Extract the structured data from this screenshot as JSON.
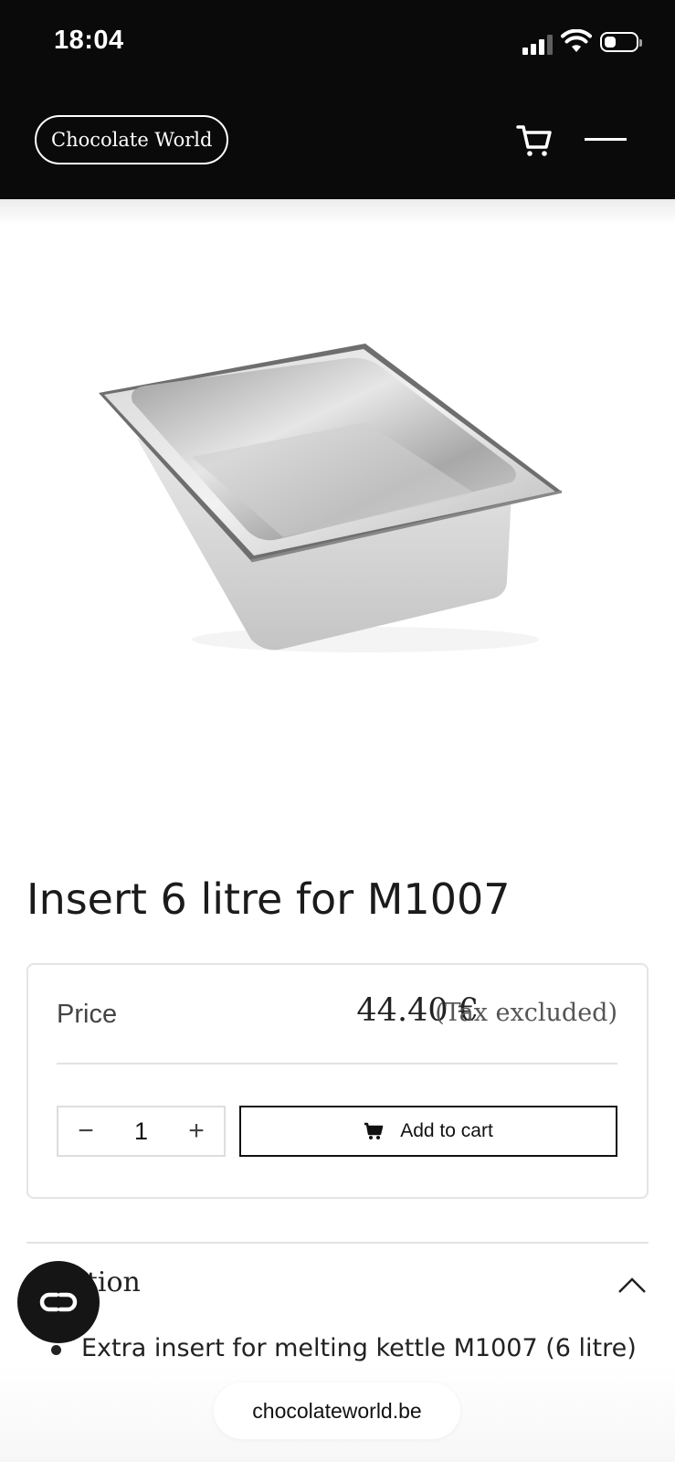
{
  "status_bar": {
    "time": "18:04",
    "icons": [
      "cellular-signal-icon",
      "wifi-icon",
      "battery-icon"
    ]
  },
  "header": {
    "brand": "Chocolate World",
    "icons": [
      "cart-icon",
      "menu-icon"
    ],
    "background": "#0a0a0a"
  },
  "product": {
    "title": "Insert 6 litre for M1007",
    "image_alt": "stainless steel gastronorm pan",
    "price_label": "Price",
    "price": "44.40 €",
    "tax_note": "(Tax excluded)",
    "quantity": "1",
    "decrement_symbol": "−",
    "increment_symbol": "+",
    "add_to_cart_label": "Add to cart"
  },
  "description": {
    "heading_visible": "iption",
    "expanded_icon": "chevron-up-icon",
    "items": [
      "Extra insert for melting kettle M1007 (6 litre)"
    ]
  },
  "chat": {
    "icon": "chat-loop-icon"
  },
  "browser": {
    "url": "chocolateworld.be"
  }
}
